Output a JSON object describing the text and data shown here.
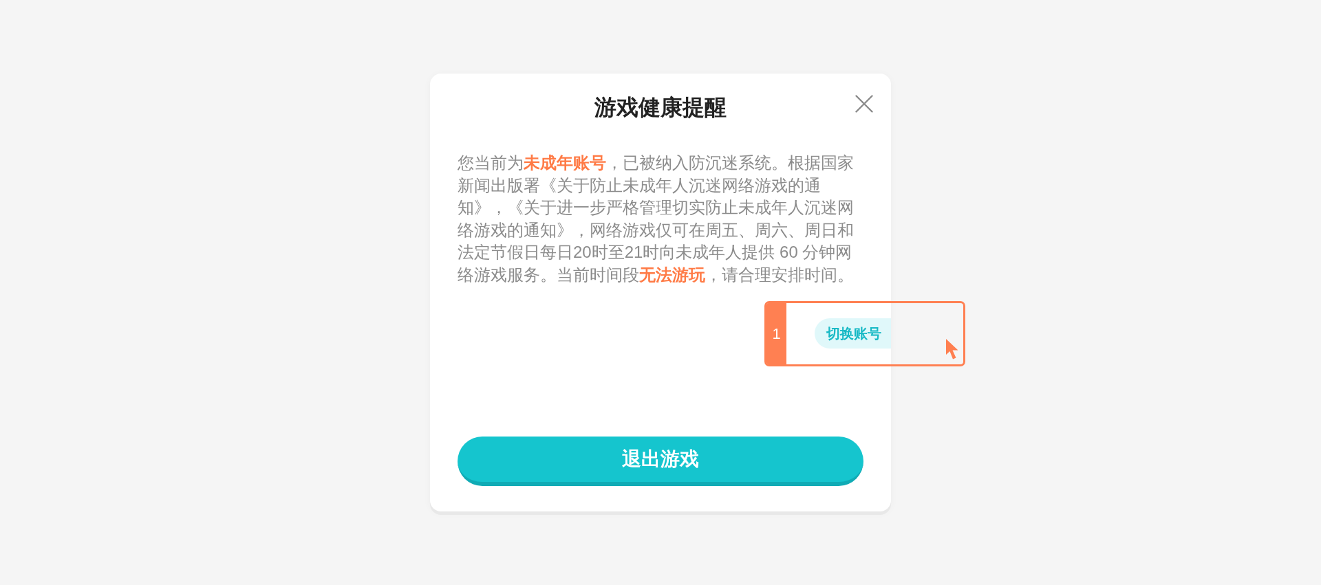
{
  "dialog": {
    "title": "游戏健康提醒",
    "message": "您当前为**未成年账号**，已被纳入防沉迷系统。根据国家新闻出版署《关于防止未成年人沉迷网络游戏的通知》，《关于进一步严格管理切实防止未成年人沉迷网络游戏的通知》，网络游戏仅可在周五、周六、周日和法定节假日每日20时至21时向未成年人提供 60 分钟网络游戏服务。当前时间段**无法游玩**，请合理安排时间。",
    "switch_account_button": "切换账号",
    "exit_button": "退出游戏"
  },
  "annotation": {
    "number": "1"
  }
}
